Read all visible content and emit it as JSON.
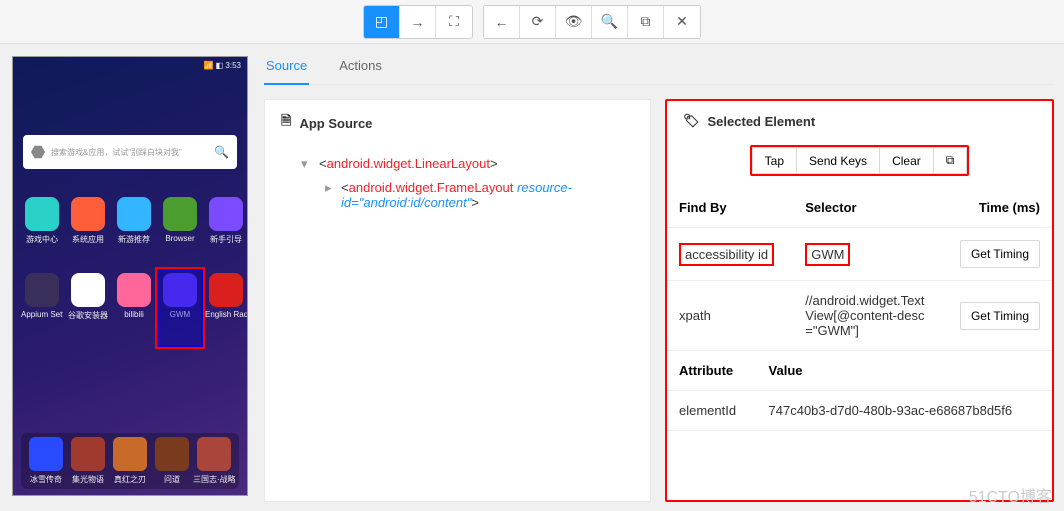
{
  "toolbar": {
    "groups": [
      {
        "buttons": [
          {
            "name": "select-mode-icon",
            "glyph": "◰",
            "active": true
          },
          {
            "name": "swipe-mode-icon",
            "glyph": "→",
            "active": false
          },
          {
            "name": "tap-coords-icon",
            "glyph": "⛶",
            "active": false
          }
        ]
      },
      {
        "buttons": [
          {
            "name": "back-icon",
            "glyph": "←",
            "active": false
          },
          {
            "name": "refresh-icon",
            "glyph": "⟳",
            "active": false
          },
          {
            "name": "eye-icon",
            "glyph": "👁",
            "active": false
          },
          {
            "name": "search-icon",
            "glyph": "🔍",
            "active": false
          },
          {
            "name": "copy-icon",
            "glyph": "⧉",
            "active": false
          },
          {
            "name": "close-icon",
            "glyph": "✕",
            "active": false
          }
        ]
      }
    ]
  },
  "device": {
    "status_time": "3:53",
    "search_placeholder": "搜索游戏&应用，试试“别踩白块对我”",
    "apps_row1": [
      {
        "label": "游戏中心",
        "color": "#2ad1c9"
      },
      {
        "label": "系统应用",
        "color": "#ff5e3a"
      },
      {
        "label": "新游推荐",
        "color": "#33b6ff"
      },
      {
        "label": "Browser",
        "color": "#4a9d2e"
      },
      {
        "label": "新手引导",
        "color": "#7b4cff"
      }
    ],
    "apps_row2": [
      {
        "label": "Appium Sett…",
        "color": "#3a2e5a"
      },
      {
        "label": "谷歌安装器",
        "color": "#ffffff"
      },
      {
        "label": "bilibili",
        "color": "#ff6699"
      },
      {
        "label": "GWM",
        "color": "#6a3fff",
        "selected": true
      },
      {
        "label": "English Radio",
        "color": "#d9201f"
      }
    ],
    "dock": [
      {
        "label": "冰雪传奇",
        "color": "#2a4aff"
      },
      {
        "label": "集光物语",
        "color": "#a03a2e"
      },
      {
        "label": "真红之刃",
        "color": "#c76a2a"
      },
      {
        "label": "问道",
        "color": "#7a3a1e"
      },
      {
        "label": "三国志·战略…",
        "color": "#a9453a"
      }
    ]
  },
  "tabs": {
    "source": "Source",
    "actions": "Actions"
  },
  "appsource": {
    "title": "App Source",
    "nodes": [
      {
        "depth": 0,
        "tag": "android.widget.LinearLayout",
        "attr": "",
        "expanded": true
      },
      {
        "depth": 1,
        "tag": "android.widget.FrameLayout",
        "attr": "resource-id=\"android:id/content\"",
        "expanded": false
      }
    ]
  },
  "selected": {
    "title": "Selected Element",
    "actions": {
      "tap": "Tap",
      "sendkeys": "Send Keys",
      "clear": "Clear"
    },
    "headers": {
      "findby": "Find By",
      "selector": "Selector",
      "time": "Time (ms)"
    },
    "rows": [
      {
        "findby": "accessibility id",
        "selector": "GWM",
        "action": "Get Timing",
        "highlight": true
      },
      {
        "findby": "xpath",
        "selector": "//android.widget.TextView[@content-desc=\"GWM\"]",
        "action": "Get Timing",
        "highlight": false
      }
    ],
    "attr_headers": {
      "attribute": "Attribute",
      "value": "Value"
    },
    "attr_rows": [
      {
        "attribute": "elementId",
        "value": "747c40b3-d7d0-480b-93ac-e68687b8d5f6"
      }
    ]
  },
  "watermark": "51CTO博客"
}
